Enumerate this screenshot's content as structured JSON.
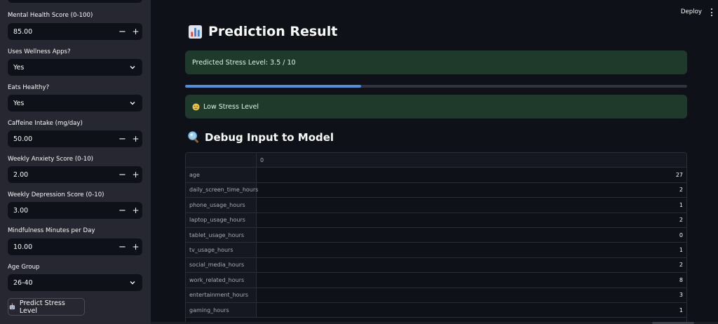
{
  "sidebar": {
    "fields": [
      {
        "type": "number",
        "label": "Mental Health Score (0-100)",
        "value": "85.00"
      },
      {
        "type": "select",
        "label": "Uses Wellness Apps?",
        "value": "Yes"
      },
      {
        "type": "select",
        "label": "Eats Healthy?",
        "value": "Yes"
      },
      {
        "type": "number",
        "label": "Caffeine Intake (mg/day)",
        "value": "50.00"
      },
      {
        "type": "number",
        "label": "Weekly Anxiety Score (0-10)",
        "value": "2.00"
      },
      {
        "type": "number",
        "label": "Weekly Depression Score (0-10)",
        "value": "3.00"
      },
      {
        "type": "number",
        "label": "Mindfulness Minutes per Day",
        "value": "10.00"
      },
      {
        "type": "select",
        "label": "Age Group",
        "value": "26-40"
      }
    ],
    "stepper_minus": "−",
    "stepper_plus": "+",
    "predict_button": "Predict Stress Level",
    "predict_icon": "robot-icon"
  },
  "header": {
    "deploy_label": "Deploy"
  },
  "main": {
    "title": "Prediction Result",
    "title_icon": "bar-chart-icon",
    "prediction_text": "Predicted Stress Level: 3.5 / 10",
    "progress_fraction": 0.35,
    "stress_label": "Low Stress Level",
    "stress_icon": "relieved-face-icon",
    "debug_title": "Debug Input to Model",
    "debug_icon": "magnifier-icon",
    "table": {
      "column_header": "0",
      "rows": [
        {
          "key": "age",
          "value": "27"
        },
        {
          "key": "daily_screen_time_hours",
          "value": "2"
        },
        {
          "key": "phone_usage_hours",
          "value": "1"
        },
        {
          "key": "laptop_usage_hours",
          "value": "2"
        },
        {
          "key": "tablet_usage_hours",
          "value": "0"
        },
        {
          "key": "tv_usage_hours",
          "value": "1"
        },
        {
          "key": "social_media_hours",
          "value": "2"
        },
        {
          "key": "work_related_hours",
          "value": "8"
        },
        {
          "key": "entertainment_hours",
          "value": "3"
        },
        {
          "key": "gaming_hours",
          "value": "1"
        }
      ]
    }
  },
  "colors": {
    "background": "#0e1117",
    "sidebar": "#262730",
    "success_bg": "#1f3a2b",
    "progress": "#4e8fdc"
  }
}
